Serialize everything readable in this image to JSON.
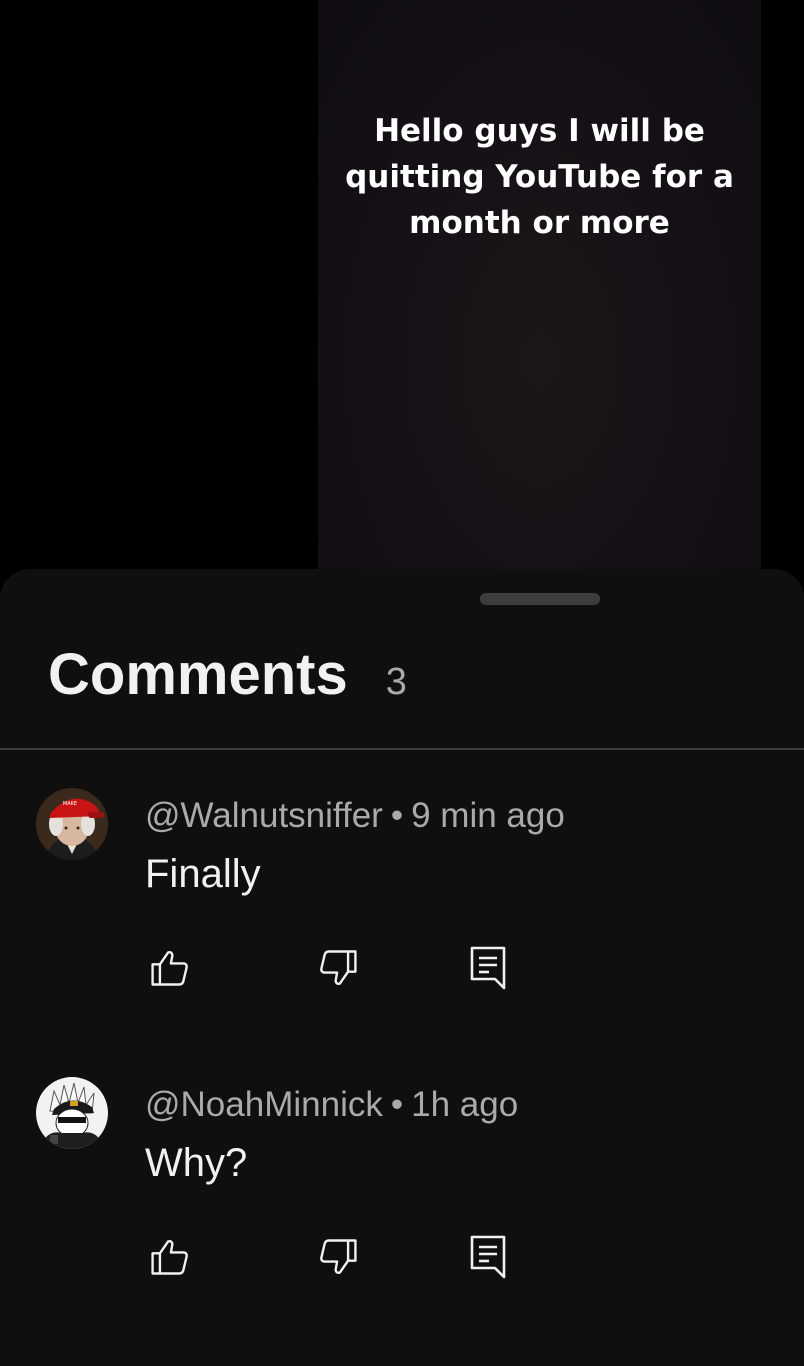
{
  "video": {
    "overlay_text": "Hello guys I will be quitting YouTube for a month or more"
  },
  "comments_panel": {
    "title": "Comments",
    "count": "3",
    "comments": [
      {
        "author": "@Walnutsniffer",
        "time": "9 min ago",
        "text": "Finally",
        "avatar_icon": "red-cap-portrait-avatar"
      },
      {
        "author": "@NoahMinnick",
        "time": "1h ago",
        "text": "Why?",
        "avatar_icon": "anime-character-avatar"
      }
    ],
    "separator": "•",
    "icons": {
      "like": "thumbs-up-icon",
      "dislike": "thumbs-down-icon",
      "reply": "reply-comment-icon"
    }
  },
  "colors": {
    "sheet_background": "#0f0f0f",
    "secondary_text": "#aaaaaa",
    "primary_text": "#f1f1f1"
  }
}
